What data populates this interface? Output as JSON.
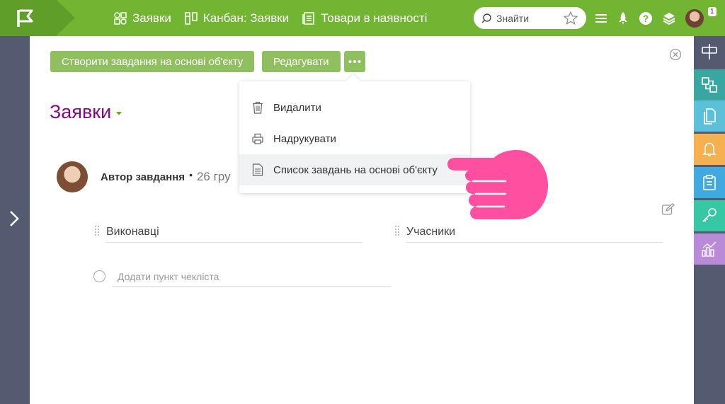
{
  "topbar": {
    "nav": [
      {
        "label": "Заявки",
        "icon": "shapes-icon"
      },
      {
        "label": "Канбан: Заявки",
        "icon": "kanban-icon"
      },
      {
        "label": "Товари в наявності",
        "icon": "book-icon"
      }
    ],
    "search_placeholder": "Знайти",
    "notification_count": "1"
  },
  "toolbar": {
    "create_task_label": "Створити завдання на основі об'єкту",
    "edit_label": "Редагувати"
  },
  "page": {
    "title": "Заявки",
    "author_label": "Автор завдання",
    "date": "26 гру"
  },
  "fields": {
    "executors_label": "Виконавці",
    "participants_label": "Учасники",
    "checklist_placeholder": "Додати пункт чекліста"
  },
  "dropdown": {
    "items": [
      {
        "label": "Видалити",
        "icon": "trash-icon"
      },
      {
        "label": "Надрукувати",
        "icon": "printer-icon"
      },
      {
        "label": "Список завдань на основі об'єкту",
        "icon": "document-list-icon"
      }
    ]
  },
  "colors": {
    "topbar": "#72b533",
    "button": "#8fbf5e",
    "title": "#800b80",
    "rail": "#545a70",
    "hand": "#ff4fa0"
  },
  "right_rail": [
    {
      "icon": "signpost-icon",
      "color": "#545a70"
    },
    {
      "icon": "flow-icon",
      "color": "#3aa6a0"
    },
    {
      "icon": "files-icon",
      "color": "#5bc0d8"
    },
    {
      "icon": "bell-icon",
      "color": "#f5b04f"
    },
    {
      "icon": "clipboard-icon",
      "color": "#3fa9e0"
    },
    {
      "icon": "key-icon",
      "color": "#36c7a4"
    },
    {
      "icon": "chart-icon",
      "color": "#b98ad8"
    }
  ]
}
